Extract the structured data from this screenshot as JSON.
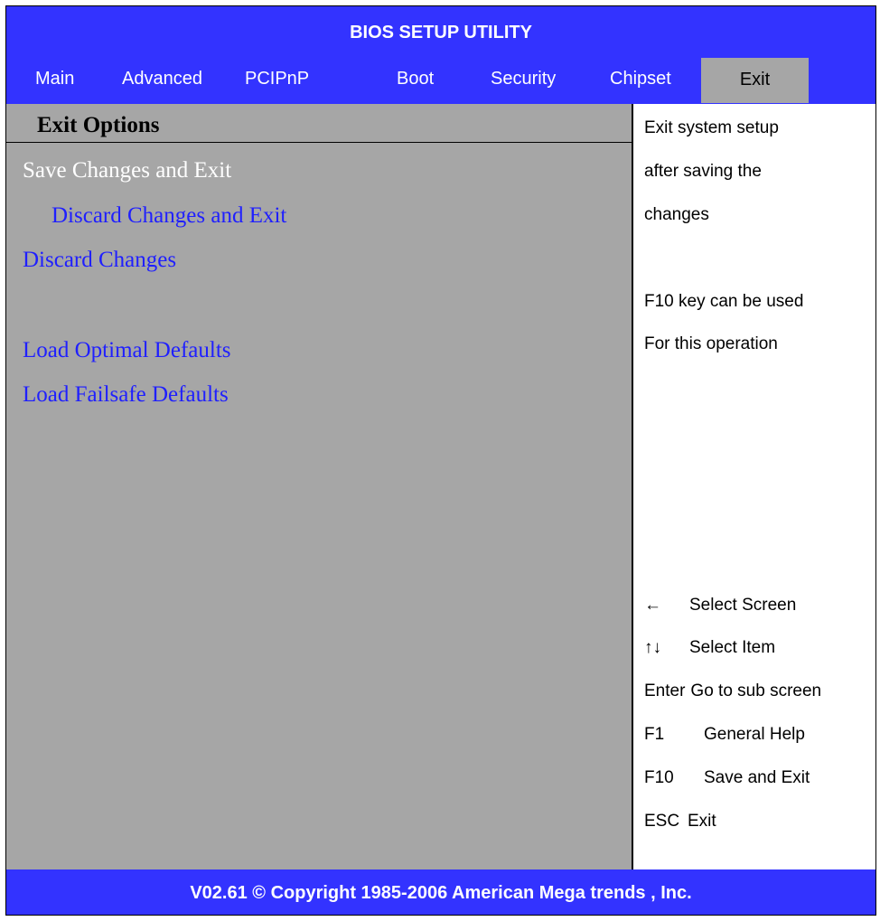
{
  "title": "BIOS SETUP UTILITY",
  "tabs": [
    {
      "label": "Main"
    },
    {
      "label": "Advanced"
    },
    {
      "label": "PCIPnP"
    },
    {
      "label": "Boot"
    },
    {
      "label": "Security"
    },
    {
      "label": "Chipset"
    },
    {
      "label": "Exit",
      "active": true
    }
  ],
  "section_title": "Exit Options",
  "options": [
    {
      "label": "Save Changes and Exit",
      "selected": true
    },
    {
      "label": "Discard Changes and Exit"
    },
    {
      "label": "Discard Changes"
    },
    {
      "label": "Load Optimal Defaults"
    },
    {
      "label": "Load Failsafe Defaults"
    }
  ],
  "help": [
    "Exit system setup",
    "after saving the",
    "changes",
    "F10 key can be used",
    "For this operation"
  ],
  "keys": [
    {
      "key": "←",
      "desc": "Select Screen"
    },
    {
      "key": "↑↓",
      "desc": "Select Item"
    },
    {
      "key": "Enter",
      "desc": "Go to sub screen"
    },
    {
      "key": "F1",
      "desc": "General Help"
    },
    {
      "key": "F10",
      "desc": "Save and Exit"
    },
    {
      "key": "ESC",
      "desc": "Exit"
    }
  ],
  "footer": "V02.61 © Copyright 1985-2006 American Mega trends , Inc.",
  "colors": {
    "header_blue": "#3333ff",
    "panel_gray": "#a6a6a6",
    "option_blue": "#1f1fff",
    "selected_white": "#ffffff"
  }
}
